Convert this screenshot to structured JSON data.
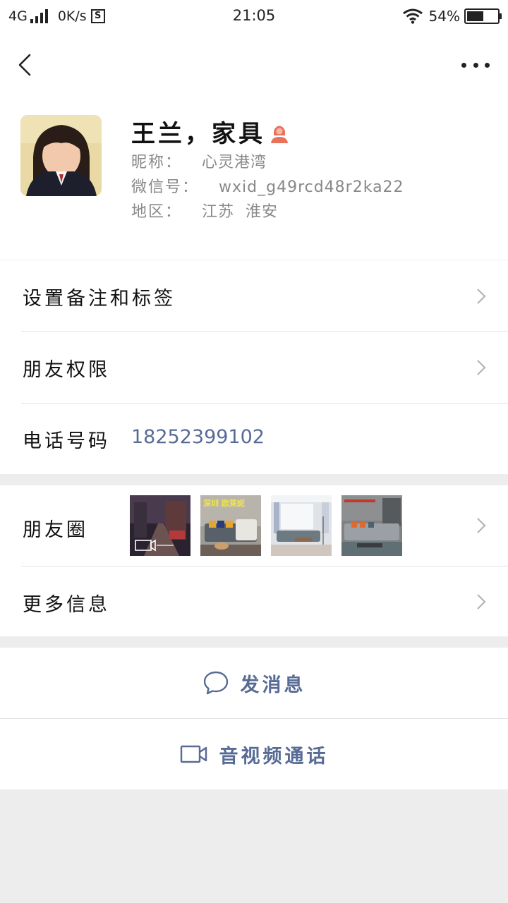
{
  "status_bar": {
    "network": "4G",
    "speed": "0K/s",
    "sim_icon_label": "S",
    "time": "21:05",
    "battery_percent": "54%",
    "battery_level": 0.54
  },
  "profile": {
    "name": "王兰，家具",
    "nickname_label": "昵称：",
    "nickname": "心灵港湾",
    "wechat_id_label": "微信号：",
    "wechat_id": "wxid_g49rcd48r2ka22",
    "region_label": "地区：",
    "region": "江苏  淮安",
    "gender_icon": "female-user-icon"
  },
  "cells": {
    "remark_tags": "设置备注和标签",
    "friend_permissions": "朋友权限",
    "phone_label": "电话号码",
    "phone_value": "18252399102",
    "moments_label": "朋友圈",
    "more_info": "更多信息"
  },
  "moments_photos": {
    "photo2_caption": "深圳 欧莱妮"
  },
  "actions": {
    "send_message": "发消息",
    "video_call": "音视频通话"
  },
  "colors": {
    "link_blue": "#576b95",
    "gender_icon": "#e8735a",
    "background": "#ededed"
  }
}
